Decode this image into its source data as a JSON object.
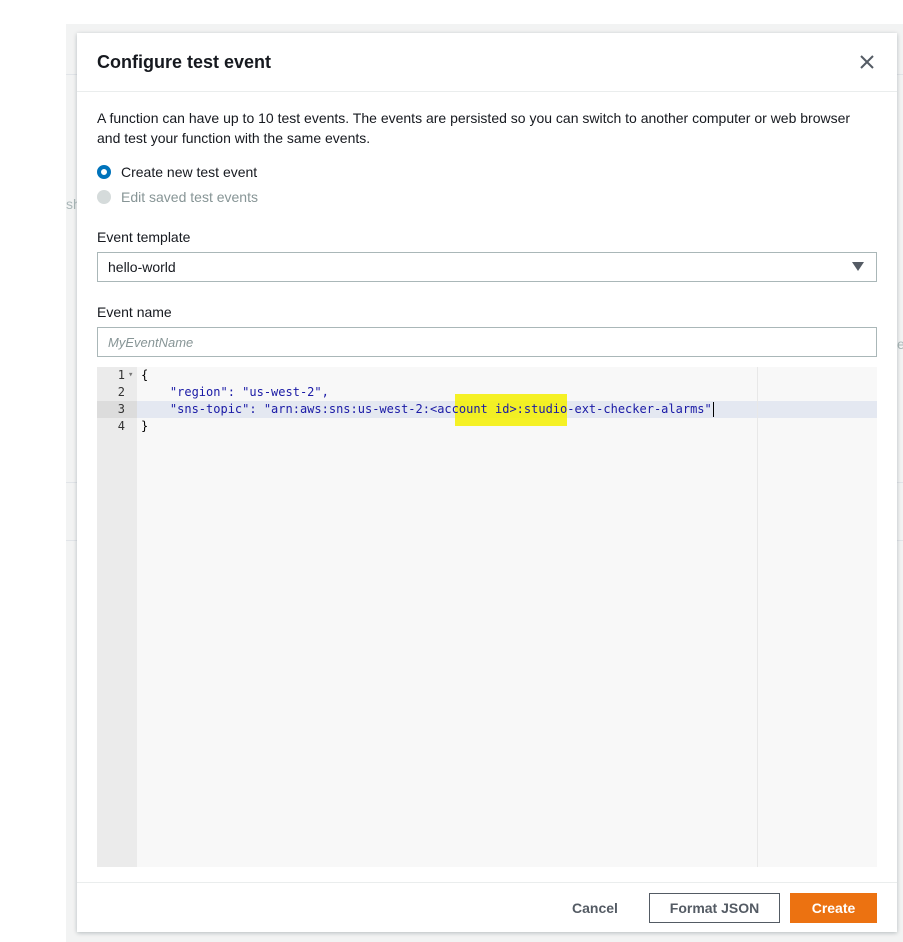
{
  "background": {
    "fragment_left": "sh",
    "fragment_right": "e"
  },
  "modal": {
    "title": "Configure test event",
    "close_icon": "close-icon",
    "description": "A function can have up to 10 test events. The events are persisted so you can switch to another computer or web browser and test your function with the same events.",
    "radio_options": [
      {
        "label": "Create new test event",
        "selected": true,
        "enabled": true
      },
      {
        "label": "Edit saved test events",
        "selected": false,
        "enabled": false
      }
    ],
    "event_template": {
      "label": "Event template",
      "value": "hello-world",
      "icon": "caret-down-icon"
    },
    "event_name": {
      "label": "Event name",
      "value": "",
      "placeholder": "MyEventName"
    },
    "editor": {
      "lines": [
        {
          "number": "1",
          "text": "{",
          "fold": "▾"
        },
        {
          "number": "2",
          "text": "    \"region\": \"us-west-2\","
        },
        {
          "number": "3",
          "text": "    \"sns-topic\": \"arn:aws:sns:us-west-2:<account id>:studio-ext-checker-alarms\""
        },
        {
          "number": "4",
          "text": "}"
        }
      ],
      "active_line": 3,
      "highlight_color": "#f5f000"
    },
    "footer": {
      "cancel_label": "Cancel",
      "format_label": "Format JSON",
      "create_label": "Create"
    },
    "colors": {
      "primary": "#ec7211",
      "radio_selected": "#0073bb"
    }
  }
}
